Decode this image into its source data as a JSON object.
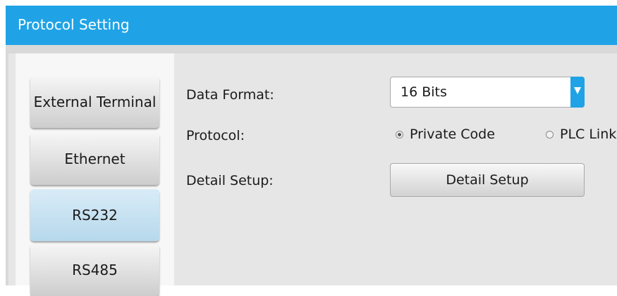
{
  "window": {
    "title": "Protocol Setting"
  },
  "sidebar": {
    "items": [
      {
        "label": "External Terminal",
        "active": false
      },
      {
        "label": "Ethernet",
        "active": false
      },
      {
        "label": "RS232",
        "active": true
      },
      {
        "label": "RS485",
        "active": false
      }
    ]
  },
  "form": {
    "data_format": {
      "label": "Data Format:",
      "value": "16 Bits"
    },
    "protocol": {
      "label": "Protocol:",
      "options": [
        {
          "label": "Private Code",
          "selected": true
        },
        {
          "label": "PLC Link",
          "selected": false
        }
      ]
    },
    "detail_setup": {
      "label": "Detail Setup:",
      "button_label": "Detail Setup"
    }
  },
  "colors": {
    "accent": "#1fa3e6",
    "active_tab": "#c6e2f2"
  }
}
